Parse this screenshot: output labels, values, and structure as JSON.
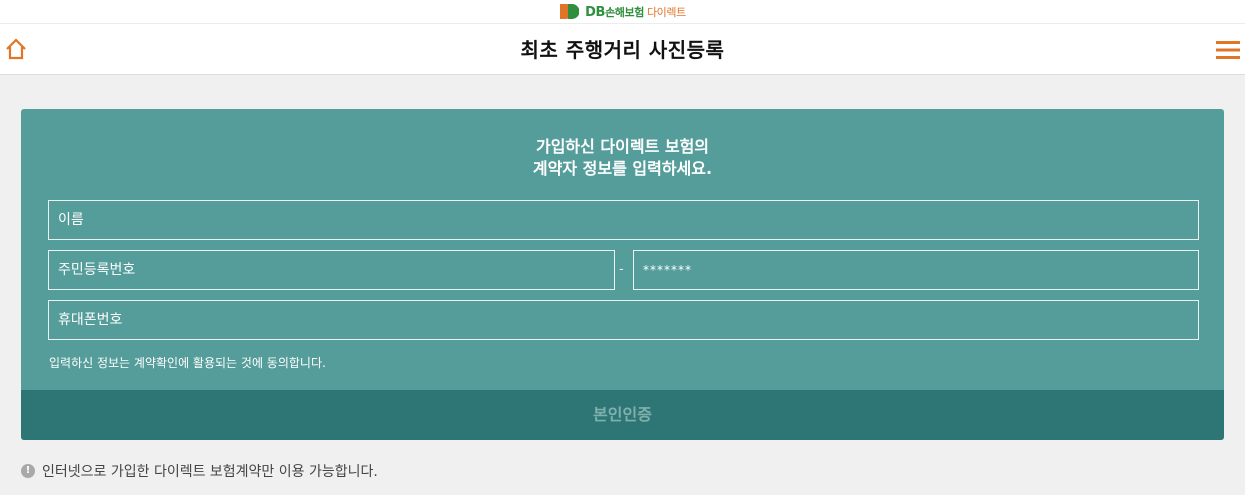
{
  "brand": {
    "db": "DB",
    "name": "손해보험",
    "direct": "다이렉트",
    "colors": {
      "green": "#2f8f3e",
      "orange": "#e07528"
    }
  },
  "header": {
    "title": "최초 주행거리 사진등록",
    "home_icon": "home-icon",
    "menu_icon": "hamburger-menu-icon",
    "accent": "#e07528"
  },
  "form": {
    "title_line1": "가입하신 다이렉트 보험의",
    "title_line2": "계약자 정보를 입력하세요.",
    "name_placeholder": "이름",
    "rrn_front_placeholder": "주민등록번호",
    "rrn_separator": "-",
    "rrn_back_placeholder": "*******",
    "phone_placeholder": "휴대폰번호",
    "consent": "입력하신 정보는 계약확인에 활용되는 것에 동의합니다.",
    "verify_label": "본인인증",
    "colors": {
      "card": "#559d9b",
      "button": "#2d7675"
    }
  },
  "notice": {
    "text": "인터넷으로 가입한 다이렉트 보험계약만 이용 가능합니다.",
    "icon": "info-icon"
  }
}
